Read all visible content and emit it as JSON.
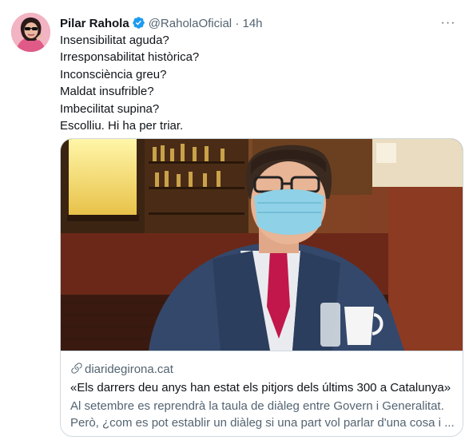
{
  "tweet": {
    "author_name": "Pilar Rahola",
    "handle": "@RaholaOficial",
    "separator": "·",
    "time": "14h",
    "more_label": "···",
    "lines": [
      "Insensibilitat aguda?",
      "Irresponsabilitat històrica?",
      "Inconsciència greu?",
      "Maldat insufrible?",
      "Imbecilitat supina?",
      "Escolliu. Hi ha per triar."
    ]
  },
  "card": {
    "domain": "diaridegirona.cat",
    "title": "«Els darrers deu anys han estat els pitjors dels últims 300 a Catalunya»",
    "description_lines": [
      "Al setembre es reprendrà la taula de diàleg entre Govern i Generalitat.",
      "Però, ¿com es pot establir un diàleg si una part vol parlar d'una cosa i ..."
    ]
  },
  "colors": {
    "verified_blue": "#1d9bf0",
    "secondary_text": "#536471",
    "border": "#cfd9de"
  },
  "icons": [
    "verified-badge-icon",
    "more-options-icon",
    "link-icon"
  ]
}
